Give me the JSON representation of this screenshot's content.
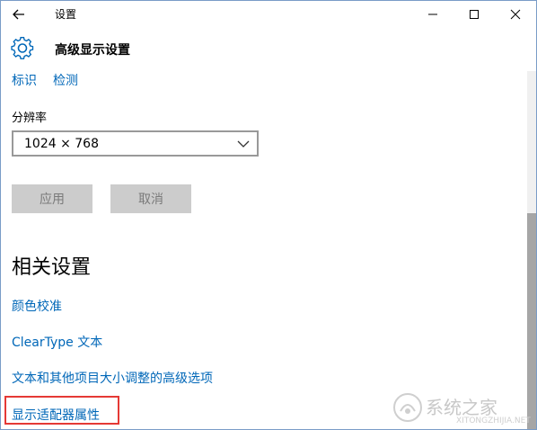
{
  "window": {
    "title": "设置",
    "controls": {
      "minimize_icon": "minimize-icon",
      "maximize_icon": "maximize-icon",
      "close_icon": "close-icon"
    }
  },
  "header": {
    "icon": "gear-icon",
    "title": "高级显示设置"
  },
  "top_links": [
    {
      "label": "标识"
    },
    {
      "label": "检测"
    }
  ],
  "resolution": {
    "label": "分辨率",
    "value": "1024 × 768"
  },
  "buttons": {
    "apply": "应用",
    "cancel": "取消"
  },
  "related": {
    "title": "相关设置",
    "links": [
      {
        "label": "颜色校准"
      },
      {
        "label": "ClearType 文本"
      },
      {
        "label": "文本和其他项目大小调整的高级选项"
      },
      {
        "label": "显示适配器属性",
        "highlighted": true
      }
    ]
  },
  "watermark": {
    "text": "系统之家",
    "sub": "XITONGZHIJIA.NET"
  },
  "colors": {
    "link": "#0067b8",
    "highlight": "#e53935",
    "button_bg": "#cccccc",
    "button_text": "#7a7a7a"
  }
}
